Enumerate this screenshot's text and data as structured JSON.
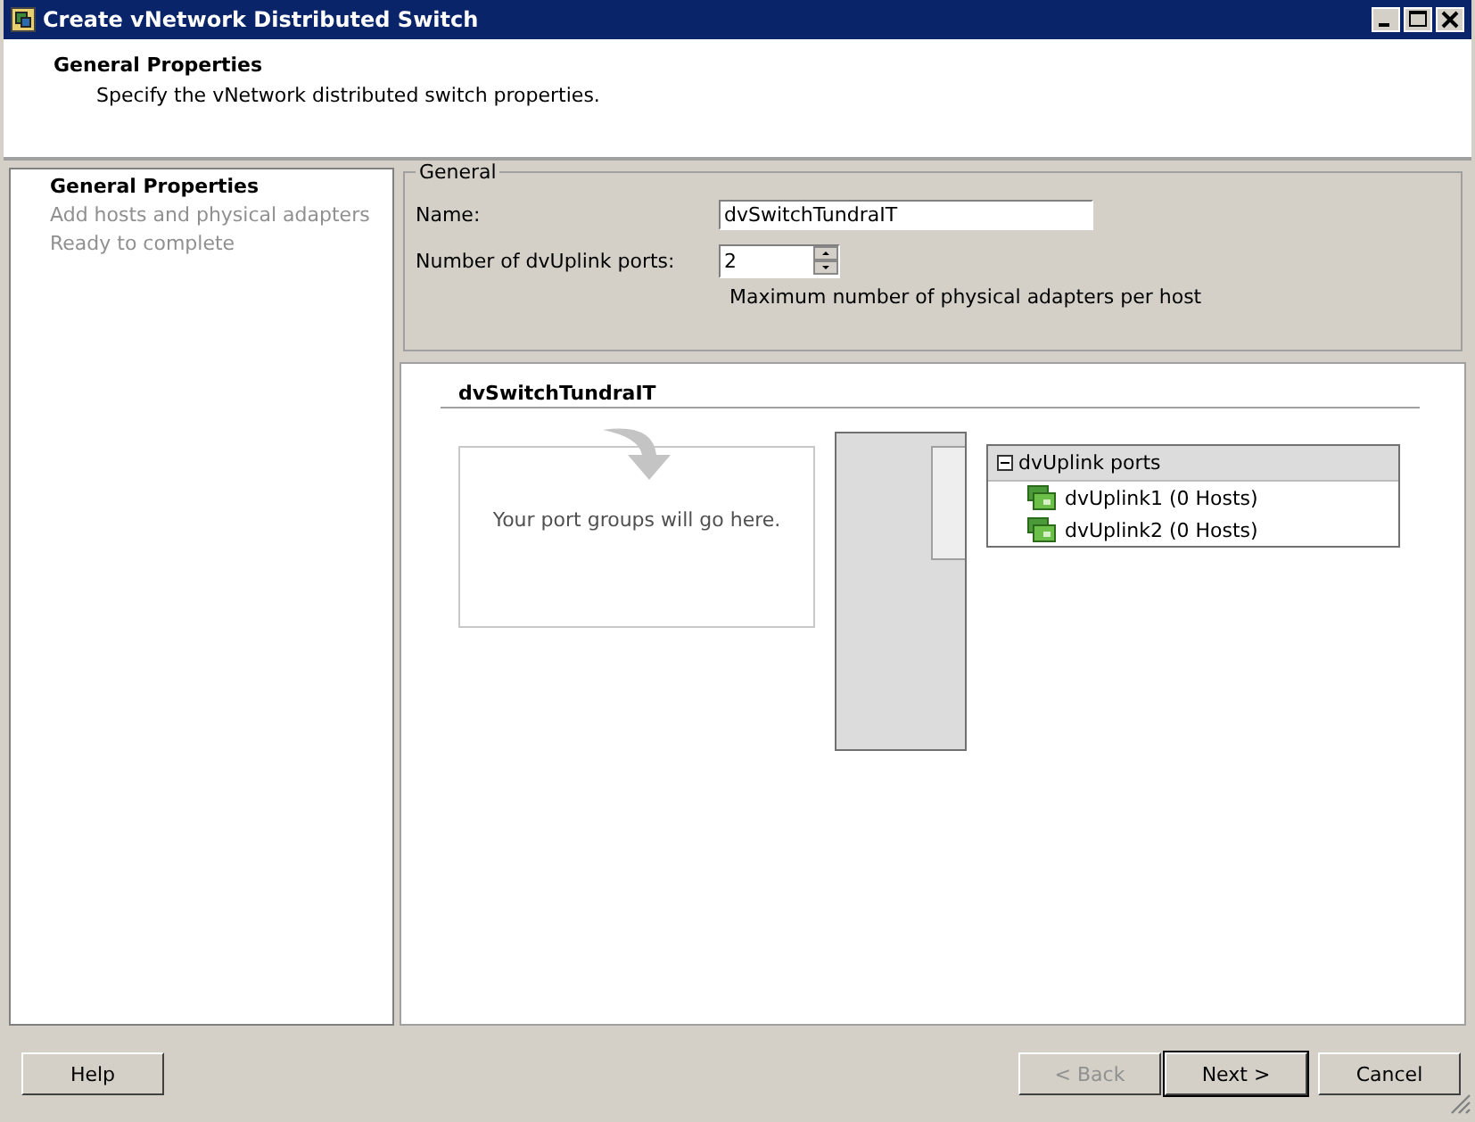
{
  "window": {
    "title": "Create vNetwork Distributed Switch"
  },
  "header": {
    "title": "General Properties",
    "subtitle": "Specify the vNetwork distributed switch properties."
  },
  "steps": [
    {
      "label": "General Properties",
      "selected": true
    },
    {
      "label": "Add hosts and physical adapters",
      "selected": false
    },
    {
      "label": "Ready to complete",
      "selected": false
    }
  ],
  "general": {
    "legend": "General",
    "name_label": "Name:",
    "name_value": "dvSwitchTundraIT",
    "ports_label": "Number of dvUplink ports:",
    "ports_value": "2",
    "ports_hint": "Maximum number of physical adapters per host"
  },
  "diagram": {
    "switch_name": "dvSwitchTundraIT",
    "placeholder_text": "Your port groups will go here.",
    "uplinks": {
      "title": "dvUplink ports",
      "expanded": true,
      "items": [
        {
          "label": "dvUplink1 (0 Hosts)"
        },
        {
          "label": "dvUplink2 (0 Hosts)"
        }
      ]
    }
  },
  "buttons": [
    {
      "label": "Help",
      "disabled": false,
      "default": false
    },
    {
      "label": "< Back",
      "disabled": true,
      "default": false
    },
    {
      "label": "Next >",
      "disabled": false,
      "default": true
    },
    {
      "label": "Cancel",
      "disabled": false,
      "default": false
    }
  ]
}
